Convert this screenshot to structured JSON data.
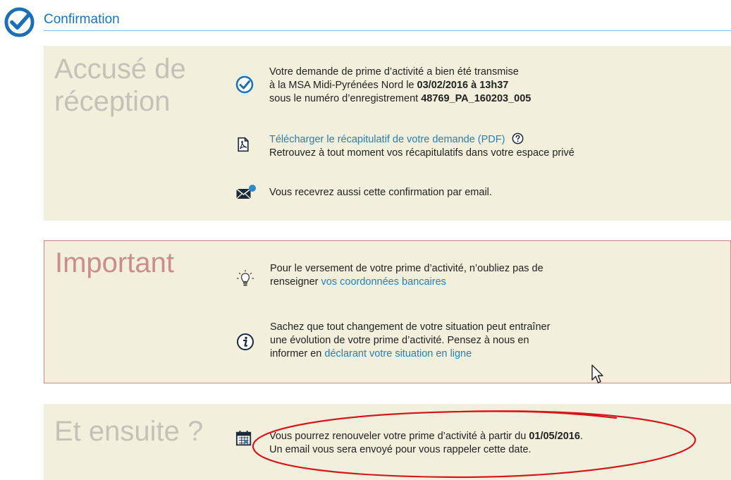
{
  "header": {
    "title": "Confirmation"
  },
  "receipt": {
    "heading_line1": "Accusé de",
    "heading_line2": "réception",
    "transmitted": {
      "line1": "Votre demande de prime d’activité a bien été transmise",
      "line2_prefix": "à la MSA Midi-Pyrénées Nord le ",
      "line2_date": "03/02/2016 à 13h37",
      "line3_prefix": "sous le numéro d’enregistrement ",
      "line3_number": "48769_PA_160203_005"
    },
    "download": {
      "link_label": "Télécharger le récapitulatif de votre demande (PDF)",
      "description": "Retrouvez à tout moment vos récapitulatifs dans votre espace privé"
    },
    "email_notice": "Vous recevrez aussi cette confirmation par email."
  },
  "important": {
    "heading": "Important",
    "bank": {
      "line1": "Pour le versement de votre prime d’activité, n’oubliez pas de",
      "line2_prefix": "renseigner ",
      "line2_link": "vos coordonnées bancaires"
    },
    "info": {
      "line1": "Sachez que tout changement de votre situation peut entraîner",
      "line2": "une évolution de votre prime d’activité. Pensez à nous en",
      "line3_prefix": "informer en ",
      "line3_link": "déclarant votre situation en ligne"
    }
  },
  "next": {
    "heading": "Et ensuite ?",
    "renewal": {
      "line1_prefix": "Vous pourrez renouveler votre prime d’activité à partir du ",
      "line1_date": "01/05/2016",
      "line1_suffix": ".",
      "line2": "Un email vous sera envoyé pour vous rappeler cette date."
    }
  },
  "colors": {
    "accent": "#1a73b8",
    "link": "#1f7fbf",
    "panel_background": "#f2f0dc",
    "important_border": "#c9878b",
    "annotation_ellipse": "#d6161d"
  },
  "icons": [
    "check-circle-icon",
    "pdf-file-icon",
    "help-icon",
    "email-icon",
    "lightbulb-icon",
    "info-icon",
    "calendar-icon",
    "mouse-cursor-icon"
  ]
}
